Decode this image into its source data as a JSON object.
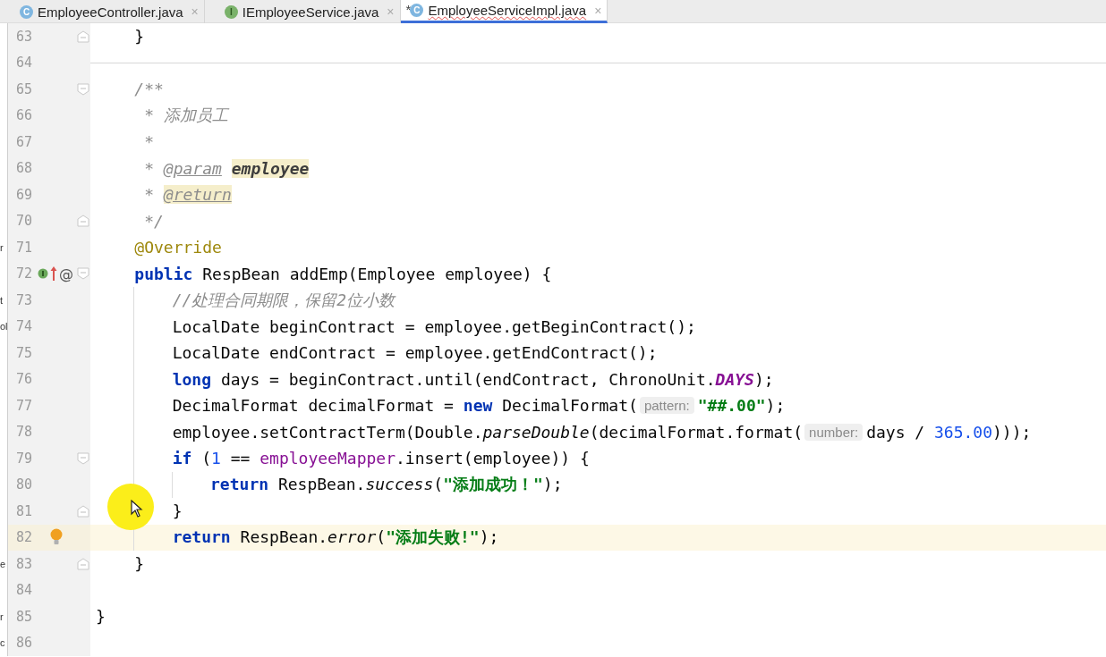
{
  "tabs": [
    {
      "kind": "class",
      "icon_letter": "C",
      "label": "EmployeeController.java",
      "close": "×",
      "selected": false
    },
    {
      "kind": "interface",
      "icon_letter": "I",
      "label": "IEmployeeService.java",
      "close": "×",
      "selected": false
    },
    {
      "kind": "class",
      "icon_letter": "C",
      "label": "EmployeeServiceImpl.java",
      "close": "×",
      "modified_mark": "*",
      "selected": true
    }
  ],
  "editor": {
    "cursor_highlight": true,
    "lines": [
      {
        "number": "63",
        "fold_marker": {
          "kind": "end"
        },
        "current": false,
        "separator": false,
        "tokens": [
          {
            "kind": "plain",
            "text": "    }"
          }
        ]
      },
      {
        "number": "64",
        "current": false,
        "separator": true
      },
      {
        "number": "65",
        "fold_marker": {
          "kind": "start"
        },
        "current": false,
        "separator": false,
        "tokens": [
          {
            "kind": "comment",
            "text": "    /**"
          }
        ]
      },
      {
        "number": "66",
        "current": false,
        "separator": false,
        "tokens": [
          {
            "kind": "comment",
            "text": "     * 添加员工"
          }
        ]
      },
      {
        "number": "67",
        "current": false,
        "separator": false,
        "tokens": [
          {
            "kind": "comment",
            "text": "     *"
          }
        ]
      },
      {
        "number": "68",
        "current": false,
        "separator": false,
        "tokens": [
          {
            "kind": "comment",
            "text": "     * "
          },
          {
            "kind": "doctag",
            "text": "@param"
          },
          {
            "kind": "docparam-hl",
            "text": "employee"
          }
        ]
      },
      {
        "number": "69",
        "current": false,
        "separator": false,
        "tokens": [
          {
            "kind": "comment",
            "text": "     * "
          },
          {
            "kind": "doctag-hl",
            "text": "@return"
          }
        ]
      },
      {
        "number": "70",
        "fold_marker": {
          "kind": "end"
        },
        "current": false,
        "separator": false,
        "tokens": [
          {
            "kind": "comment",
            "text": "     */"
          }
        ]
      },
      {
        "number": "71",
        "current": false,
        "separator": false,
        "edge_text": "r",
        "tokens": [
          {
            "kind": "annot",
            "text": "    @Override"
          }
        ]
      },
      {
        "number": "72",
        "fold_marker": {
          "kind": "start"
        },
        "current": false,
        "separator": false,
        "gutter": [
          {
            "kind": "implements"
          },
          {
            "kind": "overrides"
          },
          {
            "kind": "at",
            "text": "@"
          }
        ],
        "tokens": [
          {
            "kind": "kw",
            "text": "    public"
          },
          {
            "kind": "plain",
            "text": " RespBean addEmp(Employee employee) {"
          }
        ]
      },
      {
        "number": "73",
        "current": false,
        "separator": false,
        "edge_text": "t",
        "tokens": [
          {
            "kind": "comment",
            "text": "        //处理合同期限，保留2位小数"
          }
        ]
      },
      {
        "number": "74",
        "current": false,
        "separator": false,
        "edge_text": "ol",
        "tokens": [
          {
            "kind": "plain",
            "text": "        LocalDate beginContract = employee.getBeginContract();"
          }
        ]
      },
      {
        "number": "75",
        "current": false,
        "separator": false,
        "tokens": [
          {
            "kind": "plain",
            "text": "        LocalDate endContract = employee.getEndContract();"
          }
        ]
      },
      {
        "number": "76",
        "current": false,
        "separator": false,
        "tokens": [
          {
            "kind": "kw",
            "text": "        long"
          },
          {
            "kind": "plain",
            "text": " days = beginContract.until(endContract, ChronoUnit."
          },
          {
            "kind": "const",
            "text": "DAYS"
          },
          {
            "kind": "plain",
            "text": ");"
          }
        ]
      },
      {
        "number": "77",
        "current": false,
        "separator": false,
        "tokens": [
          {
            "kind": "plain",
            "text": "        DecimalFormat decimalFormat = "
          },
          {
            "kind": "kw",
            "text": "new"
          },
          {
            "kind": "plain",
            "text": " DecimalFormat("
          },
          {
            "kind": "hint",
            "text": "pattern:"
          },
          {
            "kind": "string",
            "text": "\"##.00\""
          },
          {
            "kind": "plain",
            "text": ");"
          }
        ]
      },
      {
        "number": "78",
        "current": false,
        "separator": false,
        "tokens": [
          {
            "kind": "plain",
            "text": "        employee.setContractTerm(Double."
          },
          {
            "kind": "static",
            "text": "parseDouble"
          },
          {
            "kind": "plain",
            "text": "(decimalFormat.format("
          },
          {
            "kind": "hint",
            "text": "number:"
          },
          {
            "kind": "plain",
            "text": "days / "
          },
          {
            "kind": "num",
            "text": "365.00"
          },
          {
            "kind": "plain",
            "text": ")));"
          }
        ]
      },
      {
        "number": "79",
        "fold_marker": {
          "kind": "start"
        },
        "current": false,
        "separator": false,
        "tokens": [
          {
            "kind": "kw",
            "text": "        if"
          },
          {
            "kind": "plain",
            "text": " ("
          },
          {
            "kind": "num",
            "text": "1"
          },
          {
            "kind": "plain",
            "text": " == "
          },
          {
            "kind": "field",
            "text": "employeeMapper"
          },
          {
            "kind": "plain",
            "text": ".insert(employee)) {"
          }
        ]
      },
      {
        "number": "80",
        "current": false,
        "separator": false,
        "tokens": [
          {
            "kind": "kw",
            "text": "            return"
          },
          {
            "kind": "plain",
            "text": " RespBean."
          },
          {
            "kind": "static",
            "text": "success"
          },
          {
            "kind": "plain",
            "text": "("
          },
          {
            "kind": "string",
            "text": "\"添加成功！\""
          },
          {
            "kind": "plain",
            "text": ");"
          }
        ]
      },
      {
        "number": "81",
        "fold_marker": {
          "kind": "end"
        },
        "current": false,
        "separator": false,
        "tokens": [
          {
            "kind": "plain",
            "text": "        }"
          }
        ]
      },
      {
        "number": "82",
        "current": true,
        "separator": false,
        "gutter": [
          {
            "kind": "bulb"
          }
        ],
        "tokens": [
          {
            "kind": "kw",
            "text": "        return"
          },
          {
            "kind": "plain",
            "text": " RespBean."
          },
          {
            "kind": "static",
            "text": "error"
          },
          {
            "kind": "plain",
            "text": "("
          },
          {
            "kind": "string",
            "text": "\"添加失败!\""
          },
          {
            "kind": "plain",
            "text": ");"
          }
        ]
      },
      {
        "number": "83",
        "fold_marker": {
          "kind": "end"
        },
        "current": false,
        "separator": false,
        "edge_text": "e",
        "tokens": [
          {
            "kind": "plain",
            "text": "    }"
          }
        ]
      },
      {
        "number": "84",
        "current": false,
        "separator": false
      },
      {
        "number": "85",
        "current": false,
        "separator": false,
        "edge_text": "r",
        "tokens": [
          {
            "kind": "plain",
            "text": "}"
          }
        ]
      },
      {
        "number": "86",
        "current": false,
        "separator": false,
        "edge_text": "c"
      }
    ]
  }
}
